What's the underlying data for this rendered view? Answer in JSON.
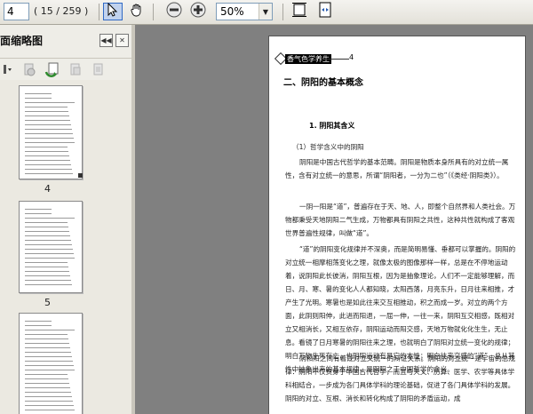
{
  "toolbar": {
    "page_value": "4",
    "page_count": "( 15 / 259 )",
    "zoom_value": "50%",
    "icons": [
      "select-tool-icon",
      "hand-tool-icon",
      "zoom-out-icon",
      "zoom-in-icon",
      "fit-page-icon",
      "fit-width-icon"
    ]
  },
  "panel": {
    "title": "面缩略图",
    "thumb_labels": [
      "4",
      "5"
    ]
  },
  "document": {
    "header_tag": "香气色学养生",
    "header_page": "4",
    "heading": "二、阴阳的基本概念",
    "subheading": "1. 阴阳其含义",
    "paragraphs": [
      "（1）哲学含义中的阴阳",
      "阴阳是中国古代哲学的基本范畴。阴阳是物质本身所具有的对立统一属性，含有对立统一的意思，所谓“阴阳者，一分为二也”（《类经·阴阳类》）。",
      "一阴一阳是“道”，普遍存在于天、地、人，即整个自然界和人类社会。万物都秉受天地阴阳二气生成，万物都具有阴阳之共性，这种共性就构成了客观世界普遍性规律，叫做“道”。",
      "“道”的阴阳变化规律并不深奥，而是简明易懂、垂都可以掌握的。阴阳的对立统一相摩相荡变化之理，就像太极的图像那样一样，总是在不停地运动着，说阴阳此长彼消，阴阳互根，因为是抽象理论，人们不一定能够理解，而日、月、寒、暑的变化人人都知晓，太阳西落，月亮东升，日月往来相推，才产生了光明。寒暑也是如此往来交互相推动，积之而成一岁。对立的两个方面，此阴则阳伸，此进而阳退，一屈一伸，一往一来，阴阳互交相感，既相对立又相消长，又相互依存，阴阳运动而阳交感，天地万物就化化生生，无止息。看镜了日月寒暑的阴阳往来之理，也就明白了阴阳对立统一变化的规律；明白万物生死存亡，也阴阳运动有是它的本性；明白往来交感的“道”，总从其性中抽象出来的基本规律，是阴阳之于中国哲学的含义。",
      "阴和阳之间有着既对立又统一的辩证关系。阴阳的对立统一是宇宙的总规律：阴阳不仅贯穿于中国古代哲学，而且与天文、历算、医学、农学等具体学科相结合，一步成为各门具体学科的理论基础，促进了各门具体学科的发展。阴阳的对立、互根、消长和转化构成了阴阳的矛盾运动，成"
    ]
  }
}
